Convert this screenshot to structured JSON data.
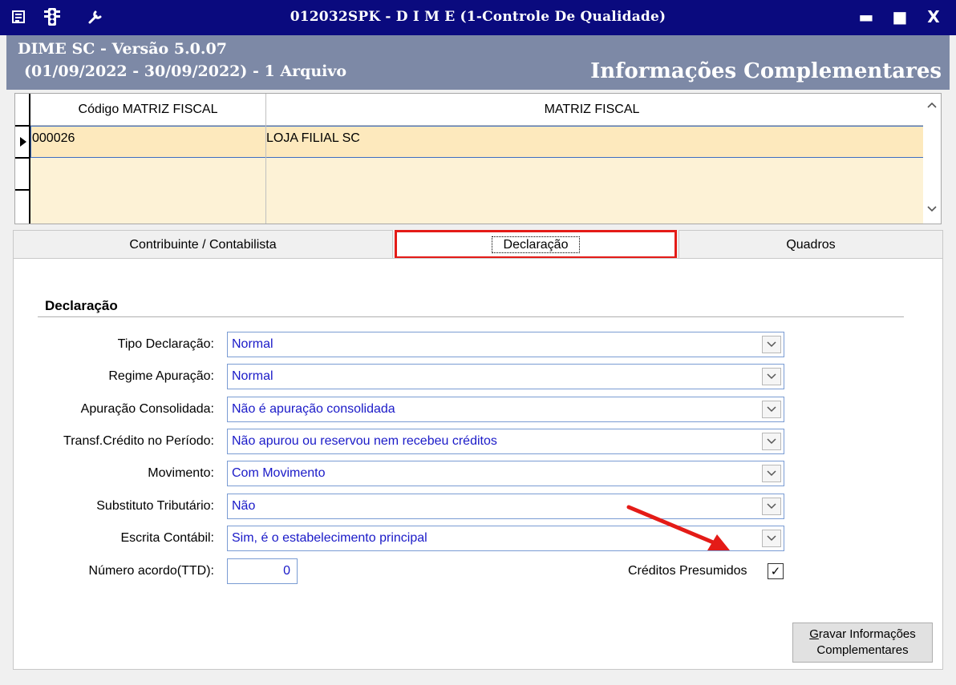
{
  "window": {
    "title": "012032SPK - D I M E (1-Controle De Qualidade)",
    "icons": [
      "menu-icon",
      "traffic-light-icon",
      "wrench-icon"
    ],
    "controls": [
      "minimize",
      "maximize",
      "close"
    ],
    "minimize_glyph": "▬",
    "maximize_glyph": "■",
    "close_glyph": "X"
  },
  "header": {
    "version": "DIME SC - Versão 5.0.07",
    "period": "(01/09/2022 - 30/09/2022) - 1 Arquivo",
    "title": "Informações Complementares"
  },
  "grid": {
    "columns": [
      "Código MATRIZ FISCAL",
      "MATRIZ FISCAL"
    ],
    "rows": [
      {
        "codigo": "000026",
        "matriz": "LOJA FILIAL SC",
        "selected": true
      }
    ]
  },
  "tabs": [
    {
      "label": "Contribuinte / Contabilista",
      "active": false
    },
    {
      "label": "Declaração",
      "active": true
    },
    {
      "label": "Quadros",
      "active": false
    }
  ],
  "panel": {
    "section_title": "Declaração",
    "fields": [
      {
        "label": "Tipo Declaração:",
        "value": "Normal"
      },
      {
        "label": "Regime Apuração:",
        "value": "Normal"
      },
      {
        "label": "Apuração Consolidada:",
        "value": "Não é apuração consolidada"
      },
      {
        "label": "Transf.Crédito no Período:",
        "value": "Não apurou ou reservou nem recebeu créditos"
      },
      {
        "label": "Movimento:",
        "value": "Com Movimento"
      },
      {
        "label": "Substituto Tributário:",
        "value": "Não"
      },
      {
        "label": "Escrita Contábil:",
        "value": "Sim, é o estabelecimento principal"
      }
    ],
    "acordo": {
      "label": "Número acordo(TTD):",
      "value": "0"
    },
    "creditos": {
      "label": "Créditos Presumidos",
      "checked": true,
      "check_glyph": "✓"
    },
    "save_button": {
      "line1_first": "G",
      "line1_rest": "ravar Informações",
      "line2": "Complementares"
    }
  },
  "colors": {
    "titlebar": "#0a0a7e",
    "header_band": "#7d89a6",
    "grid_row": "#fdecc4",
    "field_text": "#1a1ac8",
    "highlight": "#e41b17"
  }
}
